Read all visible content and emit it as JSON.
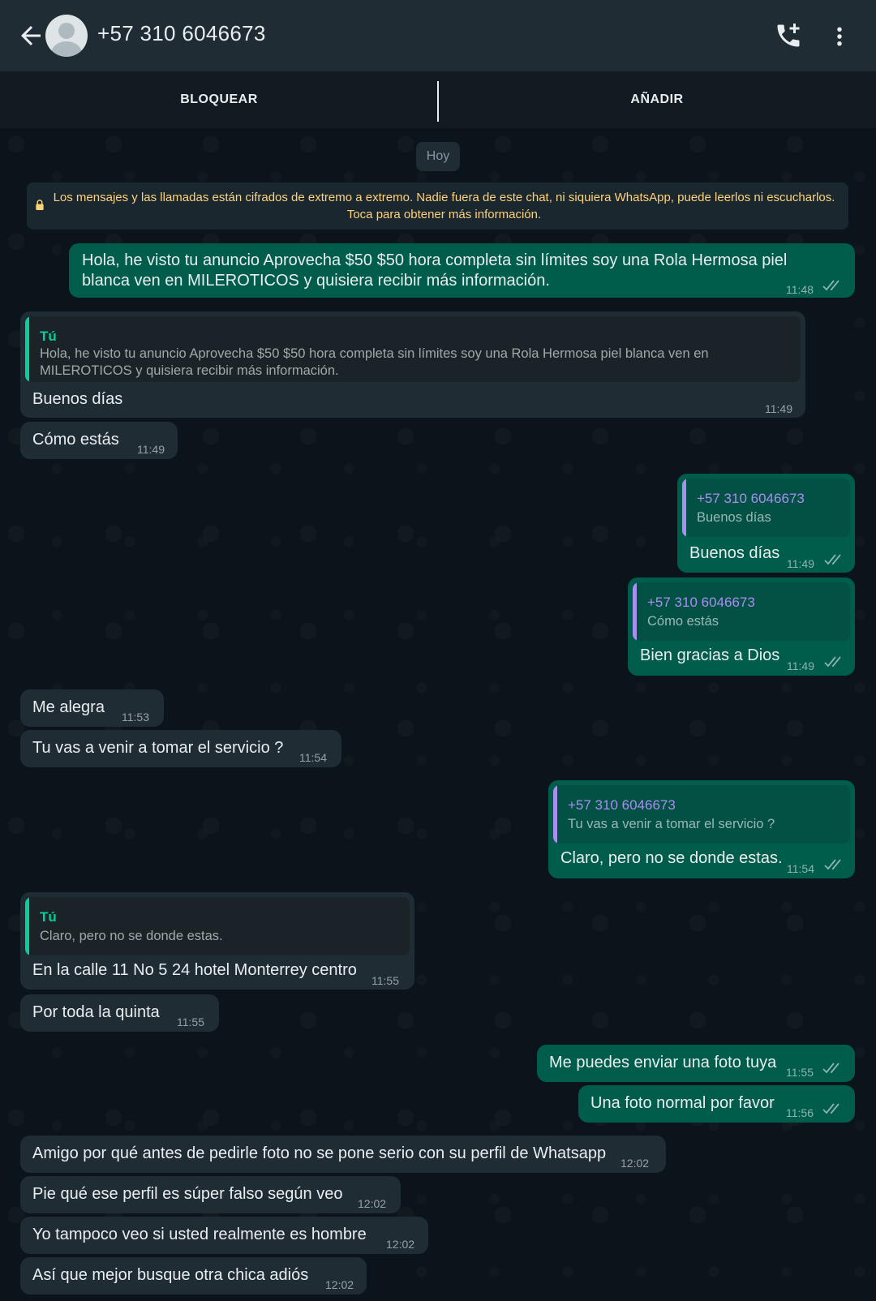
{
  "header": {
    "contact_name": "+57 310 6046673",
    "icons": {
      "back": "arrow-left-icon",
      "avatar": "avatar-placeholder-icon",
      "call": "call-add-icon",
      "menu": "more-vertical-icon"
    }
  },
  "actions": {
    "block": "BLOQUEAR",
    "add": "AÑADIR"
  },
  "day_label": "Hoy",
  "encryption_notice": "Los mensajes y las llamadas están cifrados de extremo a extremo. Nadie fuera de este chat, ni siquiera WhatsApp, puede leerlos ni escucharlos. Toca para obtener más información.",
  "colors": {
    "incoming": "#202c33",
    "outgoing": "#005c4b",
    "background": "#0b141a",
    "quote_green": "#06cf9c",
    "quote_purple": "#a88ff0",
    "notice_yellow": "#ffd279"
  },
  "messages": [
    {
      "dir": "out",
      "text": "Hola, he visto tu anuncio Aprovecha $50 $50 hora completa sin límites soy una Rola Hermosa piel blanca ven en MILEROTICOS y quisiera recibir más información.",
      "time": "11:48"
    },
    {
      "dir": "in",
      "quote_author": "Tú",
      "quote_text": "Hola, he visto tu anuncio Aprovecha $50 $50 hora completa sin límites soy una Rola Hermosa piel blanca ven en MILEROTICOS y quisiera recibir más información.",
      "text": "Buenos días",
      "time": "11:49"
    },
    {
      "dir": "in",
      "text": "Cómo estás",
      "time": "11:49"
    },
    {
      "dir": "out",
      "quote_author": "+57 310 6046673",
      "quote_text": "Buenos días",
      "text": "Buenos días",
      "time": "11:49"
    },
    {
      "dir": "out",
      "quote_author": "+57 310 6046673",
      "quote_text": "Cómo estás",
      "text": "Bien gracias a Dios",
      "time": "11:49"
    },
    {
      "dir": "in",
      "text": "Me alegra",
      "time": "11:53"
    },
    {
      "dir": "in",
      "text": "Tu vas a venir a tomar el servicio ?",
      "time": "11:54"
    },
    {
      "dir": "out",
      "quote_author": "+57 310 6046673",
      "quote_text": "Tu vas a venir a tomar el servicio ?",
      "text": "Claro, pero no se donde estas.",
      "time": "11:54"
    },
    {
      "dir": "in",
      "quote_author": "Tú",
      "quote_text": "Claro, pero no se donde estas.",
      "text": "En la calle 11 No 5 24 hotel Monterrey centro",
      "time": "11:55"
    },
    {
      "dir": "in",
      "text": "Por toda la quinta",
      "time": "11:55"
    },
    {
      "dir": "out",
      "text": "Me puedes enviar una foto tuya",
      "time": "11:55"
    },
    {
      "dir": "out",
      "text": "Una foto normal por favor",
      "time": "11:56"
    },
    {
      "dir": "in",
      "text": "Amigo por qué antes de pedirle foto no se pone serio con su perfil de Whatsapp",
      "time": "12:02"
    },
    {
      "dir": "in",
      "text": "Pie qué ese perfil es súper falso según veo",
      "time": "12:02"
    },
    {
      "dir": "in",
      "text": "Yo tampoco veo si usted realmente es hombre",
      "time": "12:02"
    },
    {
      "dir": "in",
      "text": "Así que mejor busque otra chica adiós",
      "time": "12:02"
    }
  ]
}
